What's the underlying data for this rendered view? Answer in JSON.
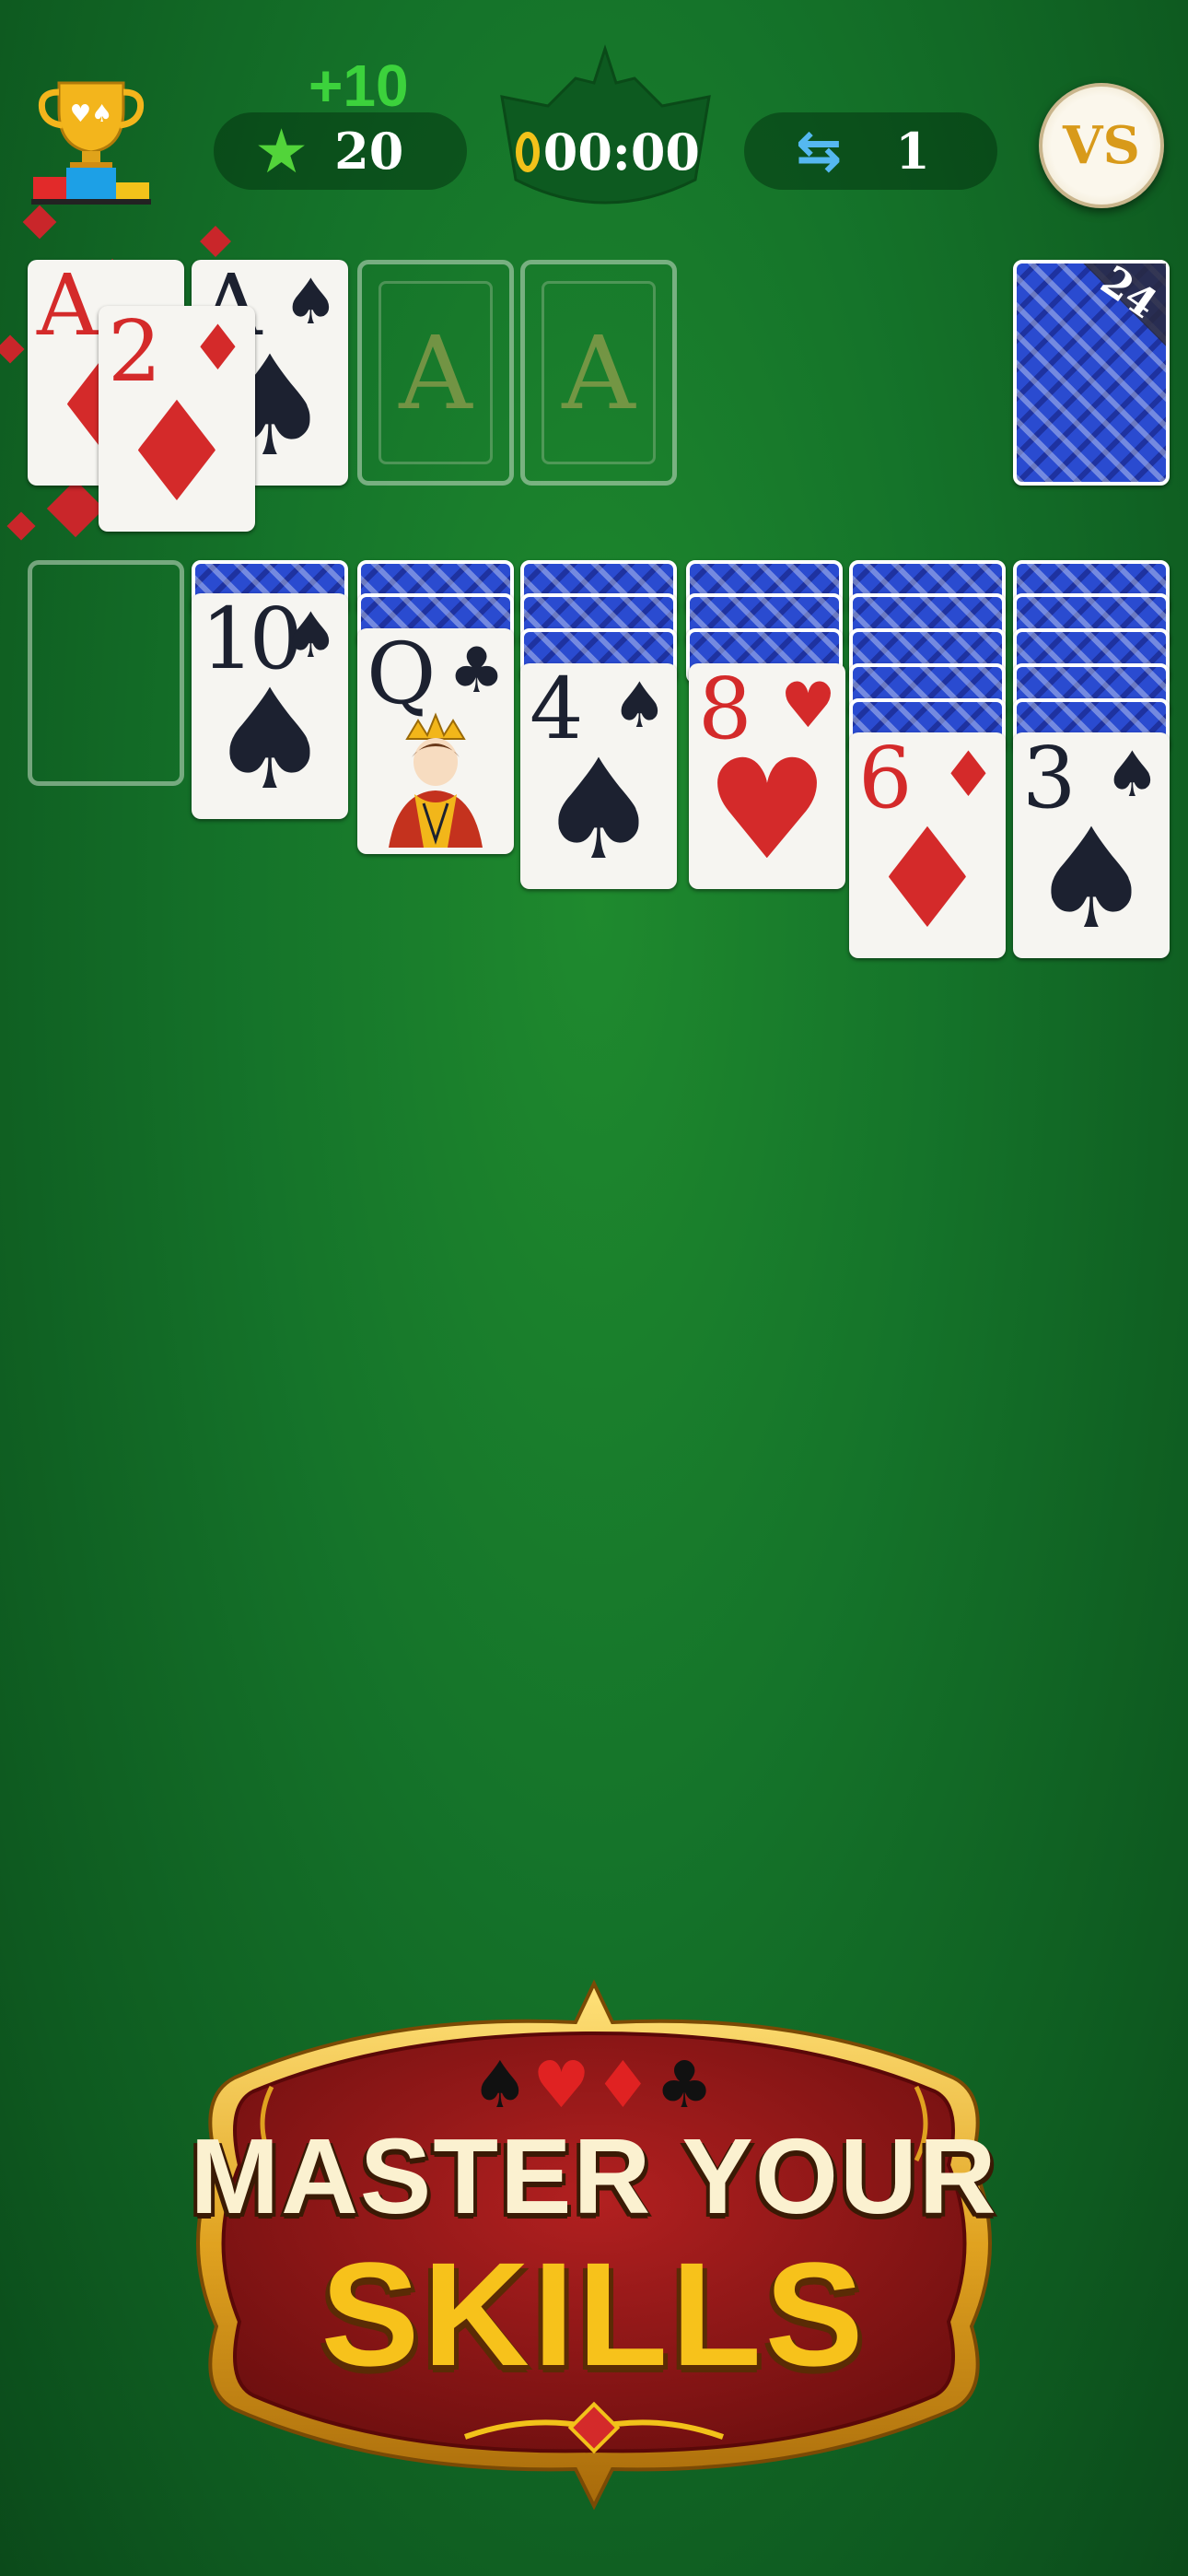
{
  "hud": {
    "bonus": "+10",
    "score": "20",
    "timer": "00:00",
    "moves": "1",
    "vs_label": "VS"
  },
  "stock": {
    "count": "24"
  },
  "foundations": [
    {
      "placeholder": "A"
    },
    {
      "placeholder": "A"
    }
  ],
  "waste_cards": [
    {
      "rank": "A",
      "suit": "♦",
      "color": "red"
    },
    {
      "rank": "A",
      "suit": "♠",
      "color": "black"
    },
    {
      "rank": "2",
      "suit": "♦",
      "color": "red"
    }
  ],
  "tableau": [
    {
      "face_down": 0,
      "face_up": []
    },
    {
      "face_down": 1,
      "face_up": [
        {
          "rank": "10",
          "suit": "♠",
          "color": "black"
        }
      ]
    },
    {
      "face_down": 2,
      "face_up": [
        {
          "rank": "Q",
          "suit": "♣",
          "color": "black",
          "face_card": "queen"
        }
      ]
    },
    {
      "face_down": 3,
      "face_up": [
        {
          "rank": "4",
          "suit": "♠",
          "color": "black"
        }
      ]
    },
    {
      "face_down": 3,
      "face_up": [
        {
          "rank": "8",
          "suit": "♥",
          "color": "red"
        }
      ]
    },
    {
      "face_down": 5,
      "face_up": [
        {
          "rank": "6",
          "suit": "♦",
          "color": "red"
        }
      ]
    },
    {
      "face_down": 5,
      "face_up": [
        {
          "rank": "3",
          "suit": "♠",
          "color": "black"
        }
      ]
    }
  ],
  "banner": {
    "line1": "MASTER YOUR",
    "line2": "SKILLS",
    "suits": "♠♥♦♣"
  },
  "colors": {
    "felt": "#15742a",
    "card_red": "#d42a2a",
    "card_black": "#1c2130",
    "card_back": "#2a4bd0",
    "bonus_green": "#3cd23c",
    "banner_red": "#9e1a1a",
    "banner_gold": "#f7c21b"
  }
}
